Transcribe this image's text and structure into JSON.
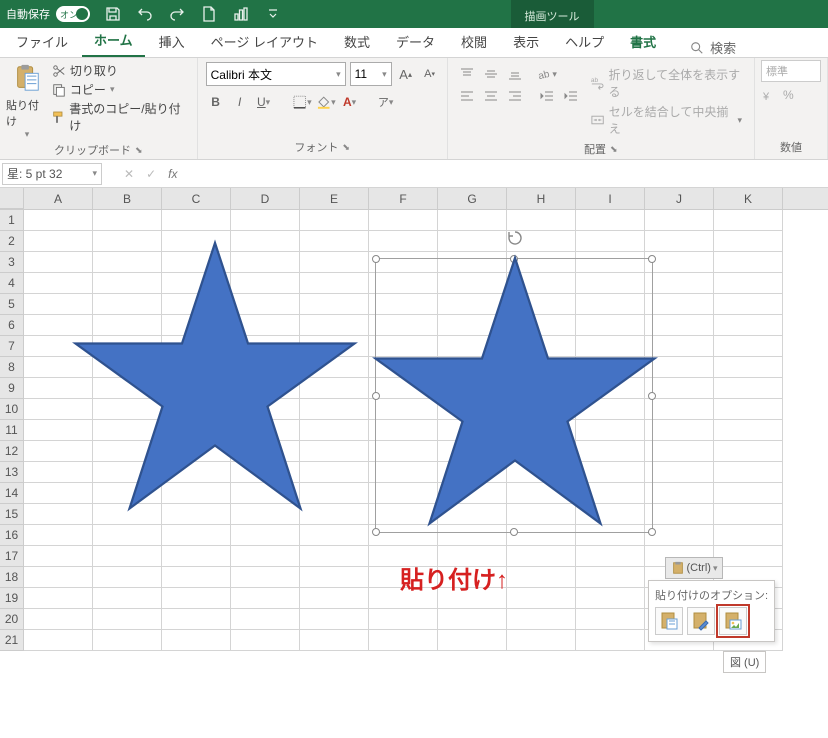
{
  "titlebar": {
    "autosave_label": "自動保存",
    "autosave_on": "オン",
    "drawing_tools": "描画ツール"
  },
  "tabs": {
    "file": "ファイル",
    "home": "ホーム",
    "insert": "挿入",
    "page_layout": "ページ レイアウト",
    "formulas": "数式",
    "data": "データ",
    "review": "校閲",
    "view": "表示",
    "help": "ヘルプ",
    "format": "書式",
    "search": "検索"
  },
  "ribbon": {
    "paste": "貼り付け",
    "cut": "切り取り",
    "copy": "コピー",
    "format_painter": "書式のコピー/貼り付け",
    "clipboard_group": "クリップボード",
    "font_group": "フォント",
    "alignment_group": "配置",
    "number_group": "数値",
    "font_name": "Calibri 本文",
    "font_size": "11",
    "wrap_text": "折り返して全体を表示する",
    "merge_center": "セルを結合して中央揃え",
    "number_format": "標準"
  },
  "namebox": "星: 5 pt 32",
  "columns": [
    "A",
    "B",
    "C",
    "D",
    "E",
    "F",
    "G",
    "H",
    "I",
    "J",
    "K"
  ],
  "rows": [
    1,
    2,
    3,
    4,
    5,
    6,
    7,
    8,
    9,
    10,
    11,
    12,
    13,
    14,
    15,
    16,
    17,
    18,
    19,
    20,
    21
  ],
  "annotation": "貼り付け↑",
  "paste_options": {
    "button": "(Ctrl)",
    "title": "貼り付けのオプション:",
    "tooltip": "図 (U)"
  },
  "shapes": {
    "star_color": "#4472c4",
    "star_border": "#2f528f"
  },
  "chart_data": null
}
